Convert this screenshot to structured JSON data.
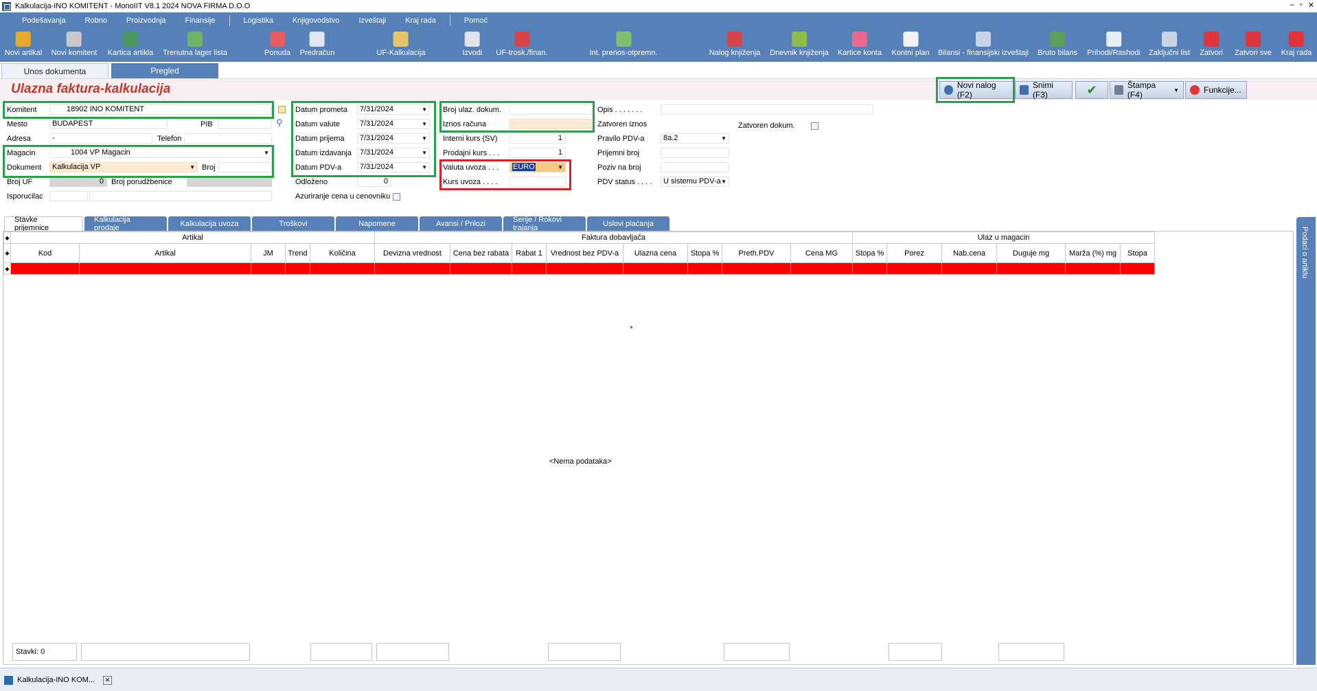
{
  "window": {
    "title": "Kalkulacija-INO KOMITENT - MonoIIT V8.1 2024 NOVA FIRMA D.O.O",
    "controls": [
      "–",
      "▫",
      "✕"
    ]
  },
  "menu": [
    "Podešavanja",
    "Robno",
    "Proizvodnja",
    "Finansije",
    "Logistika",
    "Knjigovodstvo",
    "Izveštaji",
    "Kraj rada",
    "Pomoć"
  ],
  "toolbar": [
    {
      "label": "Novi artikal",
      "icon": "new-item-icon",
      "color": "#e7a92b"
    },
    {
      "label": "Novi komitent",
      "icon": "new-client-icon",
      "color": "#c9c9c9"
    },
    {
      "label": "Kartica artikla",
      "icon": "item-card-icon",
      "color": "#4a9a5d"
    },
    {
      "label": "Trenutna lager lista",
      "icon": "stock-list-icon",
      "color": "#6fb36a"
    },
    {
      "label": "Ponuda",
      "icon": "offer-icon",
      "color": "#e55c63"
    },
    {
      "label": "Predračun",
      "icon": "proforma-icon",
      "color": "#dfe6f0"
    },
    {
      "label": "UF-Kalkulacija",
      "icon": "calc-icon",
      "color": "#e8c56a"
    },
    {
      "label": "Izvodi",
      "icon": "statements-icon",
      "color": "#e0e4ea"
    },
    {
      "label": "UF-trosk./finan.",
      "icon": "expense-icon",
      "color": "#d9434a"
    },
    {
      "label": "Int. prenos-otpremn.",
      "icon": "transfer-icon",
      "color": "#7fbf6f"
    },
    {
      "label": "Nalog knjiženja",
      "icon": "posting-icon",
      "color": "#d9434a"
    },
    {
      "label": "Dnevnik knjiženja",
      "icon": "journal-icon",
      "color": "#8bbf4a"
    },
    {
      "label": "Kartice konta",
      "icon": "account-card-icon",
      "color": "#e96a8a"
    },
    {
      "label": "Kontni plan",
      "icon": "chart-of-accounts-icon",
      "color": "#eef1f6"
    },
    {
      "label": "Bilansi - finansijski izveštaji",
      "icon": "balance-icon",
      "color": "#c9d4e6"
    },
    {
      "label": "Bruto bilans",
      "icon": "gross-balance-icon",
      "color": "#5aa05a"
    },
    {
      "label": "Prihodi/Rashodi",
      "icon": "income-icon",
      "color": "#e8edf3"
    },
    {
      "label": "Zaključni list",
      "icon": "closing-sheet-icon",
      "color": "#c9d4e6"
    },
    {
      "label": "Zatvori",
      "icon": "close-icon",
      "color": "#e0343c"
    },
    {
      "label": "Zatvori sve",
      "icon": "close-all-icon",
      "color": "#e0343c"
    },
    {
      "label": "Kraj rada",
      "icon": "power-icon",
      "color": "#e0343c"
    }
  ],
  "top_tabs": {
    "entry": "Unos dokumenta",
    "overview": "Pregled"
  },
  "doc_title": "Ulazna faktura-kalkulacija",
  "header_buttons": {
    "new": "Novi nalog (F2)",
    "save": "Snimi (F3)",
    "print": "Štampa (F4)",
    "functions": "Funkcije..."
  },
  "client": {
    "komitent_label": "Komitent",
    "komitent_value": "18902 INO KOMITENT",
    "mesto_label": "Mesto",
    "mesto_value": "BUDAPEST",
    "pib_label": "PIB",
    "adresa_label": "Adresa",
    "adresa_value": "-",
    "telefon_label": "Telefon",
    "magacin_label": "Magacin",
    "magacin_value": "1004 VP Magacin",
    "dokument_label": "Dokument",
    "dokument_value": "Kalkulacija VP",
    "broj_label": "Broj",
    "broj_uf_label": "Broj UF",
    "broj_uf_value": "0",
    "broj_por_label": "Broj porudžbenice",
    "isporucilac_label": "Isporucilac"
  },
  "dates": {
    "prometa_label": "Datum prometa",
    "prometa_value": "7/31/2024",
    "valute_label": "Datum valute",
    "valute_value": "7/31/2024",
    "prijema_label": "Datum prijema",
    "prijema_value": "7/31/2024",
    "izdavanja_label": "Datum izdavanja",
    "izdavanja_value": "7/31/2024",
    "pdv_label": "Datum PDV-a",
    "pdv_value": "7/31/2024",
    "odlozeno_label": "Odloženo",
    "odlozeno_value": "0",
    "azuriranje_label": "Azuriranje cena u cenovniku"
  },
  "invoice": {
    "broj_label": "Broj ulaz. dokum.",
    "iznos_label": "Iznos računa",
    "interni_label": "Interni kurs (SV)",
    "interni_value": "1",
    "prodajni_label": "Prodajni kurs . . .",
    "prodajni_value": "1",
    "valuta_label": "Valuta uvoza . . .",
    "valuta_value": "EURO",
    "kurs_label": "Kurs uvoza . . . ."
  },
  "right": {
    "opis_label": "Opis . . . . . . .",
    "zatvoren_iznos_label": "Zatvoren iznos",
    "zatvoren_dokum_label": "Zatvoren dokum.",
    "pravilo_label": "Pravilo PDV-a",
    "pravilo_value": "8a.2",
    "prijemni_label": "Prijemni broj",
    "poziv_label": "Poziv na broj",
    "pdv_status_label": "PDV status . . . .",
    "pdv_status_value": "U sistemu PDV-a"
  },
  "sub_tabs": [
    "Stavke prijemnice",
    "Kalkulacija prodaje",
    "Kalkulacija uvoza",
    "Troškovi",
    "Napomene",
    "Avansi / Prilozi",
    "Serije / Rokovi trajanja",
    "Uslovi plaćanja"
  ],
  "grid": {
    "groups": [
      "Artikal",
      "Faktura dobavljača",
      "Ulaz u magacin"
    ],
    "columns": [
      "Kod",
      "Artikal",
      "JM",
      "Trend",
      "Količina",
      "Devizna vrednost",
      "Cena bez rabata",
      "Rabat 1",
      "Vrednost bez PDV-a",
      "Ulazna cena",
      "Stopa %",
      "Preth.PDV",
      "Cena MG",
      "Stopa %",
      "Porez",
      "Nab.cena",
      "Duguje mg",
      "Marža (%) mg",
      "Stopa"
    ],
    "empty_text": "<Nema podataka>",
    "footer_count": "Stavki: 0"
  },
  "side_panel": "Podaci o artiklu",
  "taskbar": {
    "tab": "Kalkulacija-INO KOM..."
  },
  "colors": {
    "accent": "#5680b8",
    "title_red": "#c6372b",
    "frame_green": "#2aa04a",
    "frame_red": "#d2232a"
  }
}
